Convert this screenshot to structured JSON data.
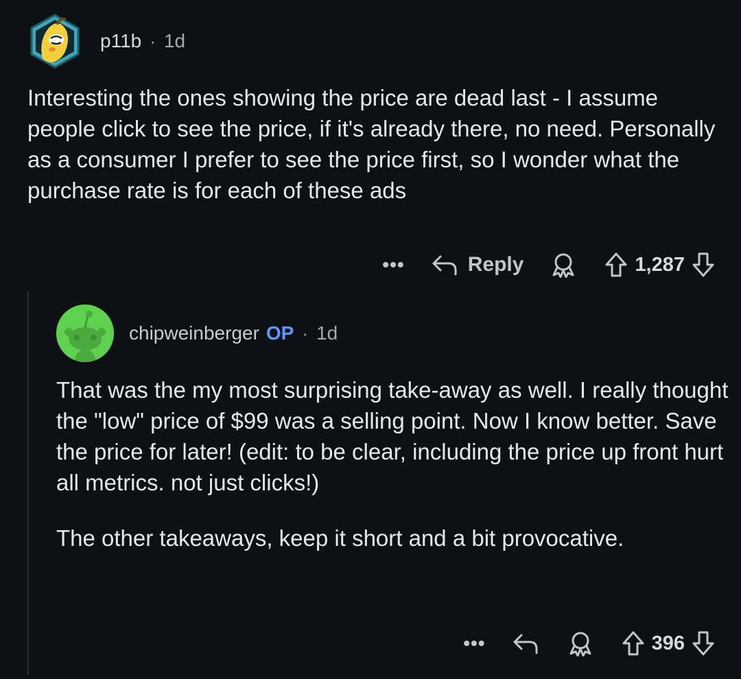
{
  "comment1": {
    "author": "p11b",
    "separator": "·",
    "time": "1d",
    "body": "Interesting the ones showing the price are dead last - I assume people click to see the price, if it's already there, no need. Personally as a consumer I prefer to see the price first, so I wonder what the purchase rate is for each of these ads",
    "actions": {
      "more_label": "•••",
      "reply_label": "Reply",
      "score": "1,287"
    },
    "icons": [
      "avatar",
      "reply-arrow-icon",
      "award-icon",
      "upvote-icon",
      "downvote-icon"
    ]
  },
  "comment2": {
    "author": "chipweinberger",
    "op_badge": "OP",
    "separator": "·",
    "time": "1d",
    "paragraphs": [
      "That was the my most surprising take-away as well. I really thought the \"low\" price of $99 was a selling point. Now I know better. Save the price for later! (edit: to be clear, including the price up front hurt all metrics. not just clicks!)",
      "The other takeaways, keep it short and a bit provocative."
    ],
    "actions": {
      "more_label": "•••",
      "score": "396"
    },
    "icons": [
      "avatar",
      "reply-arrow-icon",
      "award-icon",
      "upvote-icon",
      "downvote-icon"
    ]
  },
  "colors": {
    "background": "#0e1113",
    "text": "#e6e8ea",
    "muted": "#a6aaad",
    "op_badge": "#5a9aff",
    "avatar_green": "#5ed14e",
    "avatar_teal": "#3fa7b8",
    "avatar_yellow": "#f2cf3b"
  }
}
